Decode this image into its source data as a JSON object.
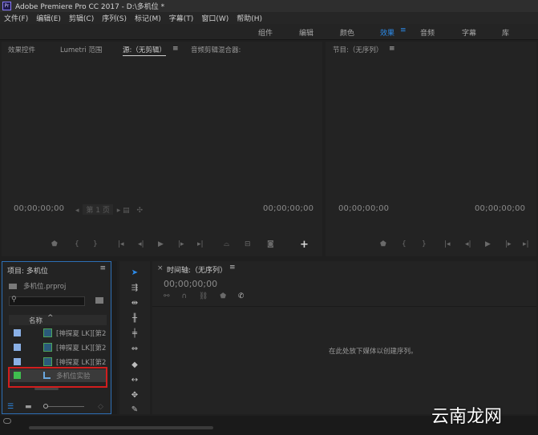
{
  "window": {
    "app_icon": "Pr",
    "title": "Adobe Premiere Pro CC 2017 - D:\\多机位 *"
  },
  "menu": [
    "文件(F)",
    "编辑(E)",
    "剪辑(C)",
    "序列(S)",
    "标记(M)",
    "字幕(T)",
    "窗口(W)",
    "帮助(H)"
  ],
  "workspaces": {
    "items": [
      "组件",
      "编辑",
      "颜色",
      "效果",
      "音频",
      "字幕",
      "库"
    ],
    "active": "效果",
    "menu_glyph": "≡"
  },
  "source_panel": {
    "tabs": [
      "效果控件",
      "Lumetri 范围",
      "源:（无剪辑）",
      "音频剪辑混合器:"
    ],
    "menu_glyph": "≡",
    "timecode_left": "00;00;00;00",
    "page_label": "第 1 页",
    "timecode_right": "00;00;00;00",
    "add_glyph": "+"
  },
  "program_panel": {
    "tab": "节目:（无序列）",
    "menu_glyph": "≡",
    "timecode_left": "00;00;00;00",
    "timecode_right": "00;00;00;00"
  },
  "project_panel": {
    "title": "项目: 多机位",
    "menu_glyph": "≡",
    "project_file": "多机位.prproj",
    "search_placeholder": "",
    "column_name": "名称",
    "items": [
      {
        "name": "[神探夏 LK][第2"
      },
      {
        "name": "[神探夏 LK][第2"
      },
      {
        "name": "[神探夏 LK][第2"
      },
      {
        "name": "多机位实验"
      }
    ]
  },
  "timeline_panel": {
    "close_glyph": "×",
    "title": "时间轴:（无序列）",
    "menu_glyph": "≡",
    "timecode": "00;00;00;00",
    "empty_hint": "在此处放下媒体以创建序列。"
  },
  "watermark": "云南龙网",
  "colors": {
    "accent_blue": "#2d8ceb",
    "selected_label": "#3fbf4f",
    "highlight_red": "#d11e1e"
  }
}
